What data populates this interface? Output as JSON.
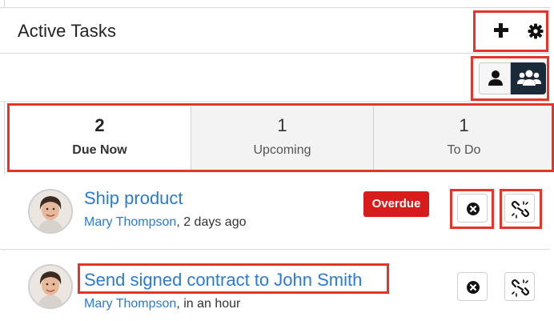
{
  "dashlet": {
    "title": "Active Tasks",
    "header_actions": [
      "plus-icon",
      "gear-icon"
    ],
    "view_toggle": [
      "user-icon",
      "users-icon"
    ]
  },
  "tabs": [
    {
      "count": "2",
      "label": "Due Now",
      "active": true
    },
    {
      "count": "1",
      "label": "Upcoming",
      "active": false
    },
    {
      "count": "1",
      "label": "To Do",
      "active": false
    }
  ],
  "tasks": [
    {
      "name": "Ship product",
      "assignee": "Mary Thompson",
      "time": ", 2 days ago",
      "badge": "Overdue",
      "actions": [
        "close-icon",
        "unlink-icon"
      ]
    },
    {
      "name": "Send signed contract to John Smith",
      "assignee": "Mary Thompson",
      "time": ", in an hour",
      "badge": "",
      "actions": [
        "close-icon",
        "unlink-icon"
      ]
    }
  ],
  "colors": {
    "highlight": "#e8332a",
    "link": "#2a7bd4",
    "overdue": "#d81c1c",
    "toggle_active": "#1b2a38"
  }
}
